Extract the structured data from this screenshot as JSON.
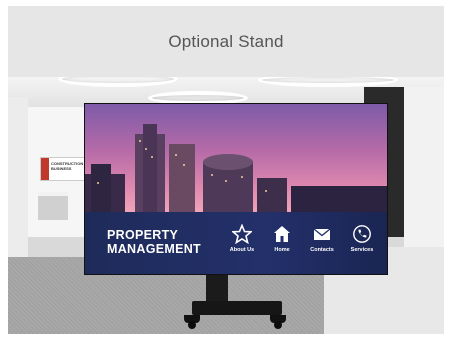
{
  "header": {
    "title": "Optional Stand"
  },
  "booth": {
    "sign_text": "CONSTRUCTION BUSINESS"
  },
  "display": {
    "brand_line1": "PROPERTY",
    "brand_line2": "MANAGEMENT",
    "nav": [
      {
        "label": "About Us",
        "icon": "star-icon"
      },
      {
        "label": "Home",
        "icon": "home-icon"
      },
      {
        "label": "Contacts",
        "icon": "envelope-icon"
      },
      {
        "label": "Services",
        "icon": "phone-icon"
      }
    ]
  },
  "colors": {
    "header_bg": "#e6e6e6",
    "header_text": "#555555",
    "screen_bar": "#23306a",
    "sky_top": "#7e5aa8",
    "sky_bottom": "#f0a5b8"
  }
}
